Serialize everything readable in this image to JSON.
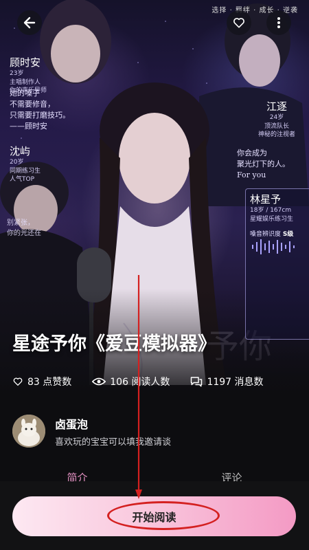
{
  "top": {
    "overlay_text": "选择 · 羁绊 · 成长 · 逆袭"
  },
  "icons": {
    "back": "back-arrow-icon",
    "favorite": "heart-icon",
    "more": "more-vertical-icon",
    "like": "heart-outline-icon",
    "views": "eye-icon",
    "messages": "chat-bubbles-icon"
  },
  "cover": {
    "characters": [
      {
        "name": "顾时安",
        "age": "23岁",
        "line1": "主唱制作人",
        "line2": "你的声乐导师"
      },
      {
        "name": "江逐",
        "age": "24岁",
        "line1": "顶流队长",
        "line2": "神秘的注视者"
      },
      {
        "name": "沈屿",
        "age": "20岁",
        "line1": "同期练习生",
        "line2": "人气TOP"
      },
      {
        "name": "林星予",
        "age": "18岁 / 167cm",
        "line1": "星耀娱乐练习生"
      }
    ],
    "quote_1": "她的嗓子\n不需要修音，\n只需要打磨技巧。\n——顾时安",
    "quote_2": "你会成为\n聚光灯下的人。\nFor you",
    "quote_3": "别紧张，\n你的光还在",
    "skill_label": "嗓音辨识度",
    "skill_rank": "S级"
  },
  "title": "星途予你《爱豆模拟器》",
  "stats": {
    "likes": "83 点赞数",
    "reads": "106 阅读人数",
    "messages": "1197 消息数"
  },
  "author": {
    "name": "卤蛋泡",
    "bio": "喜欢玩的宝宝可以填我邀请谈"
  },
  "tabs": [
    {
      "label": "简介"
    },
    {
      "label": "评论"
    }
  ],
  "read_button": {
    "label": "开始阅读"
  },
  "colors": {
    "accent_pink": "#e894c6",
    "annotation_red": "#d42020"
  }
}
